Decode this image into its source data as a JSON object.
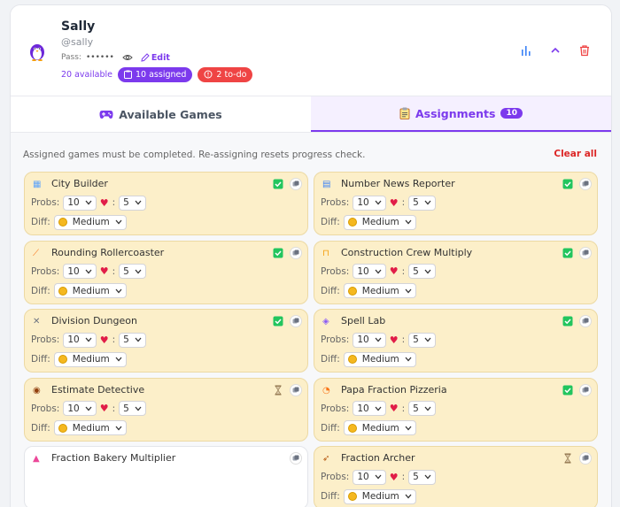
{
  "student": {
    "name": "Sally",
    "handle": "@sally",
    "pass_label": "Pass:",
    "pass_mask": "••••••",
    "edit_label": "Edit",
    "available_text": "20 available",
    "assigned_badge": "10 assigned",
    "todo_badge": "2 to-do"
  },
  "tabs": [
    {
      "label": "Available Games",
      "icon": "gamepad-icon"
    },
    {
      "label": "Assignments",
      "icon": "clipboard-icon",
      "count": "10"
    }
  ],
  "assignments": {
    "info": "Assigned games must be completed. Re-assigning resets progress check.",
    "clear_all": "Clear all",
    "probs_label": "Probs:",
    "lives_sep": ":",
    "diff_label": "Diff:",
    "games": [
      {
        "title": "City Builder",
        "icon": "city-icon",
        "status": "done",
        "probs": "10",
        "lives": "5",
        "difficulty": "Medium"
      },
      {
        "title": "Number News Reporter",
        "icon": "newspaper-icon",
        "status": "done",
        "probs": "10",
        "lives": "5",
        "difficulty": "Medium"
      },
      {
        "title": "Rounding Rollercoaster",
        "icon": "rollercoaster-icon",
        "status": "done",
        "probs": "10",
        "lives": "5",
        "difficulty": "Medium"
      },
      {
        "title": "Construction Crew Multiply",
        "icon": "crane-icon",
        "status": "done",
        "probs": "10",
        "lives": "5",
        "difficulty": "Medium"
      },
      {
        "title": "Division Dungeon",
        "icon": "swords-icon",
        "status": "done",
        "probs": "10",
        "lives": "5",
        "difficulty": "Medium"
      },
      {
        "title": "Spell Lab",
        "icon": "flask-icon",
        "status": "done",
        "probs": "10",
        "lives": "5",
        "difficulty": "Medium"
      },
      {
        "title": "Estimate Detective",
        "icon": "detective-icon",
        "status": "pending",
        "probs": "10",
        "lives": "5",
        "difficulty": "Medium"
      },
      {
        "title": "Papa Fraction Pizzeria",
        "icon": "pizza-icon",
        "status": "done",
        "probs": "10",
        "lives": "5",
        "difficulty": "Medium"
      },
      {
        "title": "Fraction Bakery Multiplier",
        "icon": "cake-icon",
        "status": "none",
        "probs": "",
        "lives": "",
        "difficulty": ""
      },
      {
        "title": "Fraction Archer",
        "icon": "bow-icon",
        "status": "pending",
        "probs": "10",
        "lives": "5",
        "difficulty": "Medium"
      }
    ]
  },
  "colors": {
    "accent": "#7c3aed",
    "danger": "#ef4444",
    "card_assigned": "#fcefc9",
    "done_check": "#22c55e"
  }
}
